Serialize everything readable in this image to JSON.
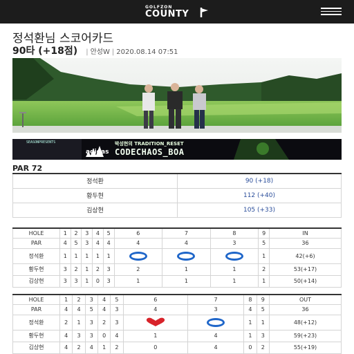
{
  "header": {
    "logo_small": "GOLFZON",
    "logo_main": "COUNTY",
    "menu_icon": "hamburger-menu-icon"
  },
  "title": "정석환님 스코어카드",
  "summary": {
    "score": "90타 (+18점)",
    "course": "안성W",
    "datetime": "2020.08.14 07:51"
  },
  "banner": {
    "small_text": "SEASONPRESENTS",
    "brand": "adidas",
    "headline": "박성현의 TRADITION_RESET",
    "code": "CODECHAOS_BOA"
  },
  "par_label": "PAR 72",
  "players": [
    {
      "name": "정석환",
      "score": "90 (+18)"
    },
    {
      "name": "황두현",
      "score": "112 (+40)"
    },
    {
      "name": "김상현",
      "score": "105 (+33)"
    }
  ],
  "front": {
    "header": [
      "HOLE",
      "1",
      "2",
      "3",
      "4",
      "5",
      "6",
      "7",
      "8",
      "9",
      "IN"
    ],
    "par": [
      "PAR",
      "4",
      "5",
      "3",
      "4",
      "4",
      "4",
      "4",
      "3",
      "5",
      "36"
    ],
    "rows": [
      {
        "name": "정석환",
        "cells": [
          "1",
          "1",
          "1",
          "1",
          "1",
          "",
          "",
          "",
          "1",
          "42(+6)"
        ]
      },
      {
        "name": "황두현",
        "cells": [
          "3",
          "2",
          "1",
          "2",
          "3",
          "2",
          "1",
          "1",
          "2",
          "53(+17)"
        ]
      },
      {
        "name": "김상현",
        "cells": [
          "3",
          "3",
          "1",
          "0",
          "3",
          "1",
          "1",
          "1",
          "1",
          "50(+14)"
        ]
      }
    ]
  },
  "back": {
    "header": [
      "HOLE",
      "1",
      "2",
      "3",
      "4",
      "5",
      "6",
      "7",
      "8",
      "9",
      "OUT"
    ],
    "par": [
      "PAR",
      "4",
      "4",
      "5",
      "4",
      "3",
      "4",
      "3",
      "4",
      "5",
      "36"
    ],
    "rows": [
      {
        "name": "정석환",
        "cells": [
          "2",
          "1",
          "3",
          "2",
          "3",
          "",
          "",
          "1",
          "1",
          "48(+12)"
        ]
      },
      {
        "name": "황두현",
        "cells": [
          "4",
          "3",
          "3",
          "0",
          "4",
          "1",
          "4",
          "1",
          "3",
          "59(+23)"
        ]
      },
      {
        "name": "김상현",
        "cells": [
          "4",
          "2",
          "4",
          "1",
          "2",
          "0",
          "4",
          "0",
          "2",
          "55(+19)"
        ]
      }
    ]
  },
  "colors": {
    "birdie_circle": "#1f66c9",
    "eagle_heart": "#d8232a",
    "score_blue": "#2a4d9a"
  }
}
